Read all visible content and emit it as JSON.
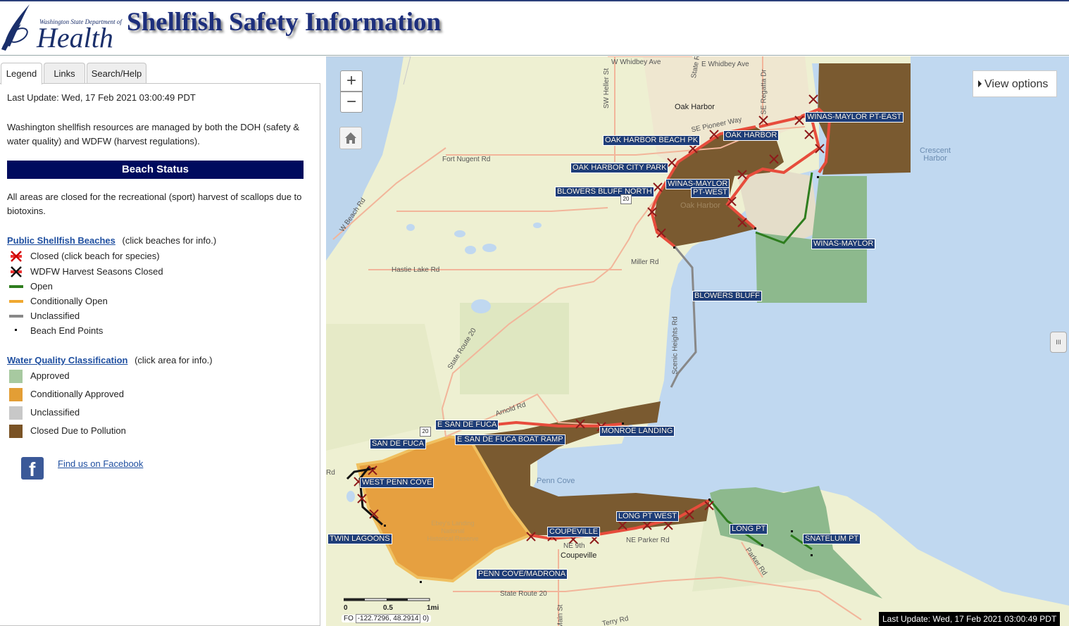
{
  "header": {
    "logo_dept": "Washington State Department of",
    "logo_name": "Health",
    "title": "Shellfish Safety Information"
  },
  "tabs": [
    {
      "label": "Legend",
      "active": true
    },
    {
      "label": "Links",
      "active": false
    },
    {
      "label": "Search/Help",
      "active": false
    }
  ],
  "legend_panel": {
    "last_update": "Last Update: Wed, 17 Feb 2021 03:00:49 PDT",
    "intro": "Washington shellfish resources are managed by both the DOH (safety & water quality) and WDFW (harvest regulations).",
    "status_heading": "Beach Status",
    "status_note": "All areas are closed for the recreational (sport) harvest of scallops due to biotoxins.",
    "beaches_link": "Public Shellfish Beaches",
    "beaches_hint": "(click beaches for info.)",
    "beach_items": [
      {
        "label": "Closed (click beach for species)",
        "icon": "red-x-icon"
      },
      {
        "label": "WDFW Harvest Seasons Closed",
        "icon": "black-x-icon"
      },
      {
        "label": "Open",
        "icon": "green-line",
        "color": "#2e7d1e"
      },
      {
        "label": "Conditionally Open",
        "icon": "orange-line",
        "color": "#f0a830"
      },
      {
        "label": "Unclassified",
        "icon": "gray-line",
        "color": "#888888"
      },
      {
        "label": "Beach End Points",
        "icon": "dot"
      }
    ],
    "water_link": "Water Quality Classification",
    "water_hint": "(click area for info.)",
    "water_items": [
      {
        "label": "Approved",
        "color": "#a7c9a0"
      },
      {
        "label": "Conditionally Approved",
        "color": "#e39e35"
      },
      {
        "label": "Unclassified",
        "color": "#c8c8c8"
      },
      {
        "label": "Closed Due to Pollution",
        "color": "#7a5325"
      }
    ],
    "facebook": "Find us on Facebook"
  },
  "map": {
    "zoom_in": "+",
    "zoom_out": "−",
    "view_options": "View options",
    "slider_glyph": "III",
    "beach_labels": [
      "WINAS-MAYLOR PT-EAST",
      "OAK HARBOR",
      "OAK HARBOR BEACH PK",
      "OAK HARBOR CITY PARK",
      "WINAS-MAYLOR",
      "PT-WEST",
      "BLOWERS BLUFF NORTH",
      "WINAS-MAYLOR",
      "BLOWERS BLUFF",
      "E SAN DE FUCA",
      "SAN DE FUCA",
      "E SAN DE FUCA BOAT RAMP",
      "MONROE LANDING",
      "WEST PENN COVE",
      "TWIN LAGOONS",
      "LONG PT WEST",
      "COUPEVILLE",
      "LONG PT",
      "SNATELUM PT",
      "PENN COVE/MADRONA"
    ],
    "place_labels": [
      "W Whidbey Ave",
      "E Whidbey Ave",
      "SE Pioneer Way",
      "Fort Nugent Rd",
      "Hastie Lake Rd",
      "Miller Rd",
      "W Beach Rd",
      "State Route 20",
      "Arnold Rd",
      "Scenic Heights Rd",
      "NE Parker Rd",
      "Parker Rd",
      "State Route 20",
      "SW Heller St",
      "SE Regatta Dr",
      "State Rte",
      "NE 9th",
      "Terry Rd",
      "Main St",
      "Rd"
    ],
    "town_labels": [
      "Oak Harbor",
      "Coupeville",
      "Oak Harbor"
    ],
    "water_labels": [
      "Crescent\nHarbor",
      "Penn Cove"
    ],
    "park_label": "Ebey's Landing\nNational\nHistorical Reserve",
    "route_shields": [
      "20",
      "20"
    ],
    "scale": {
      "ticks": [
        "0",
        "0.5",
        "1mi"
      ]
    },
    "coords": "-122.7296, 48.2914",
    "coords_prefix": "FO",
    "coords_suffix": "0)",
    "last_update": "Last Update: Wed, 17 Feb 2021 03:00:49 PDT"
  }
}
